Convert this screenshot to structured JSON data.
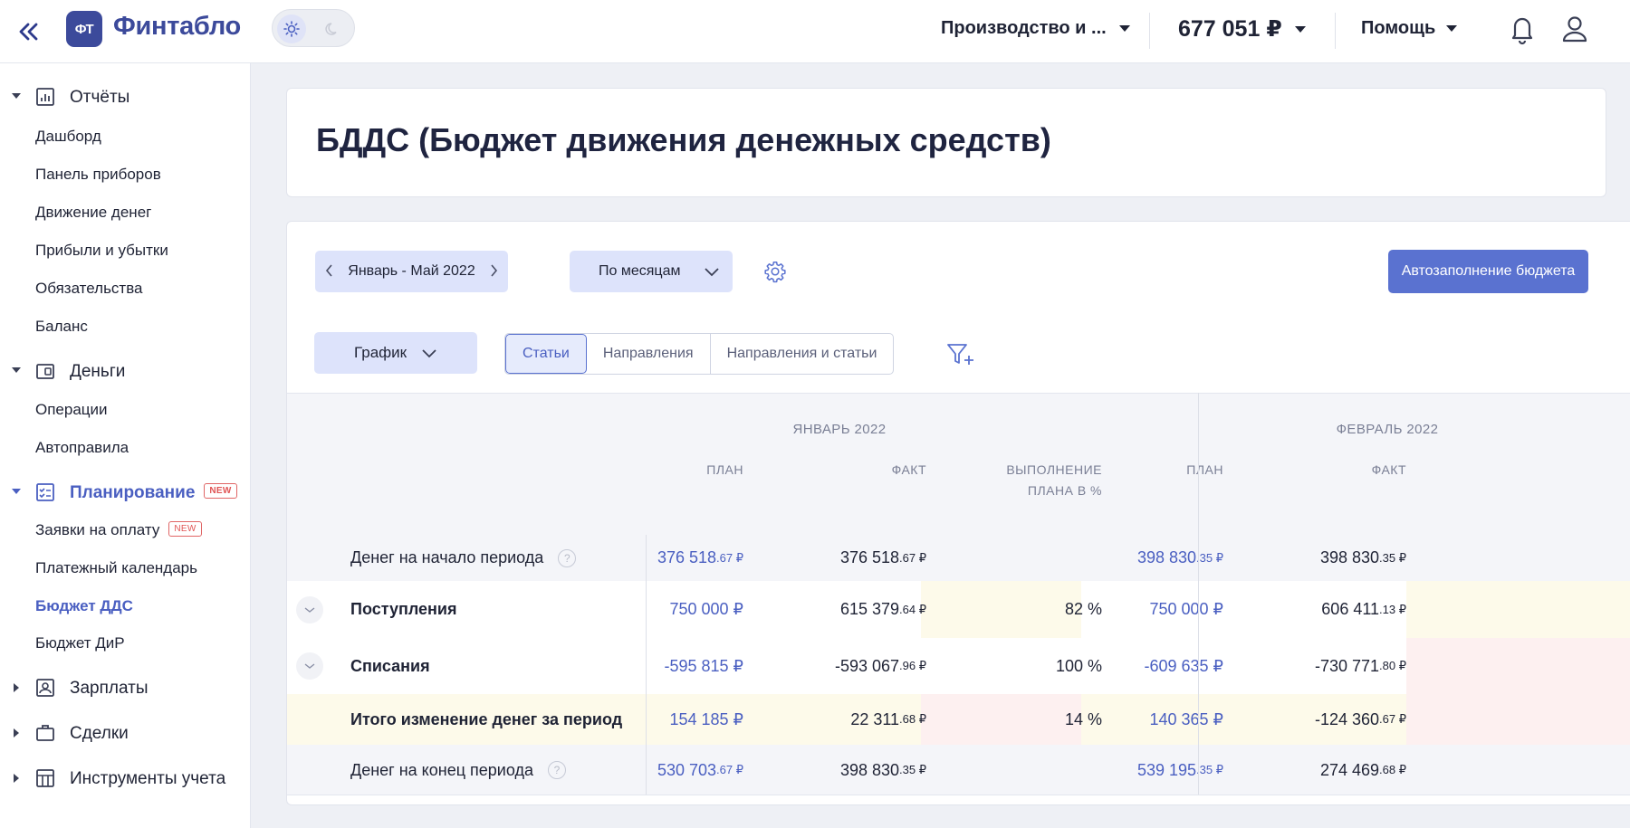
{
  "header": {
    "logo_badge": "ФТ",
    "logo_text": "Финтабло",
    "company": "Производство и ...",
    "balance": "677 051 ₽",
    "help": "Помощь"
  },
  "sidebar": {
    "reports": {
      "label": "Отчёты",
      "items": [
        "Дашборд",
        "Панель приборов",
        "Движение денег",
        "Прибыли и убытки",
        "Обязательства",
        "Баланс"
      ]
    },
    "money": {
      "label": "Деньги",
      "items": [
        "Операции",
        "Автоправила"
      ]
    },
    "planning": {
      "label": "Планирование",
      "badge": "NEW",
      "items": [
        "Заявки на оплату",
        "Платежный календарь",
        "Бюджет ДДС",
        "Бюджет ДиР"
      ],
      "item_badge": "NEW"
    },
    "salaries": "Зарплаты",
    "deals": "Сделки",
    "tools": "Инструменты учета"
  },
  "page": {
    "title": "БДДС (Бюджет движения денежных средств)"
  },
  "toolbar": {
    "period": "Январь - Май 2022",
    "grouping": "По месяцам",
    "autofill": "Автозаполнение бюджета",
    "view": "График",
    "tabs": [
      "Статьи",
      "Направления",
      "Направления и статьи"
    ],
    "active_tab": "Статьи"
  },
  "table": {
    "months": [
      "ЯНВАРЬ 2022",
      "ФЕВРАЛЬ 2022"
    ],
    "col_plan": "ПЛАН",
    "col_fact": "ФАКТ",
    "col_exec_1": "ВЫПОЛНЕНИЕ",
    "col_exec_2": "ПЛАНА В %",
    "rows": [
      {
        "label": "Денег на начало периода",
        "jan_plan": "376 518",
        "jan_plan_k": ".67 ₽",
        "jan_fact": "376 518",
        "jan_fact_k": ".67 ₽",
        "jan_pct": "",
        "feb_plan": "398 830",
        "feb_plan_k": ".35 ₽",
        "feb_fact": "398 830",
        "feb_fact_k": ".35 ₽",
        "help": "?"
      },
      {
        "label": "Поступления",
        "jan_plan": "750 000 ₽",
        "jan_plan_k": "",
        "jan_fact": "615 379",
        "jan_fact_k": ".64 ₽",
        "jan_pct": "82 %",
        "feb_plan": "750 000 ₽",
        "feb_plan_k": "",
        "feb_fact": "606 411",
        "feb_fact_k": ".13 ₽"
      },
      {
        "label": "Списания",
        "jan_plan": "-595 815 ₽",
        "jan_plan_k": "",
        "jan_fact": "-593 067",
        "jan_fact_k": ".96 ₽",
        "jan_pct": "100 %",
        "feb_plan": "-609 635 ₽",
        "feb_plan_k": "",
        "feb_fact": "-730 771",
        "feb_fact_k": ".80 ₽"
      },
      {
        "label": "Итого изменение денег за период",
        "jan_plan": "154 185 ₽",
        "jan_plan_k": "",
        "jan_fact": "22 311",
        "jan_fact_k": ".68 ₽",
        "jan_pct": "14 %",
        "feb_plan": "140 365 ₽",
        "feb_plan_k": "",
        "feb_fact": "-124 360",
        "feb_fact_k": ".67 ₽"
      },
      {
        "label": "Денег на конец периода",
        "jan_plan": "530 703",
        "jan_plan_k": ".67 ₽",
        "jan_fact": "398 830",
        "jan_fact_k": ".35 ₽",
        "jan_pct": "",
        "feb_plan": "539 195",
        "feb_plan_k": ".35 ₽",
        "feb_fact": "274 469",
        "feb_fact_k": ".68 ₽",
        "help": "?"
      }
    ]
  },
  "colors": {
    "accent": "#4a5fc1",
    "button_primary": "#5a72d0",
    "button_light": "#dde3fb",
    "highlight_yellow": "#fdfaea",
    "highlight_red": "#fdf0f0"
  }
}
